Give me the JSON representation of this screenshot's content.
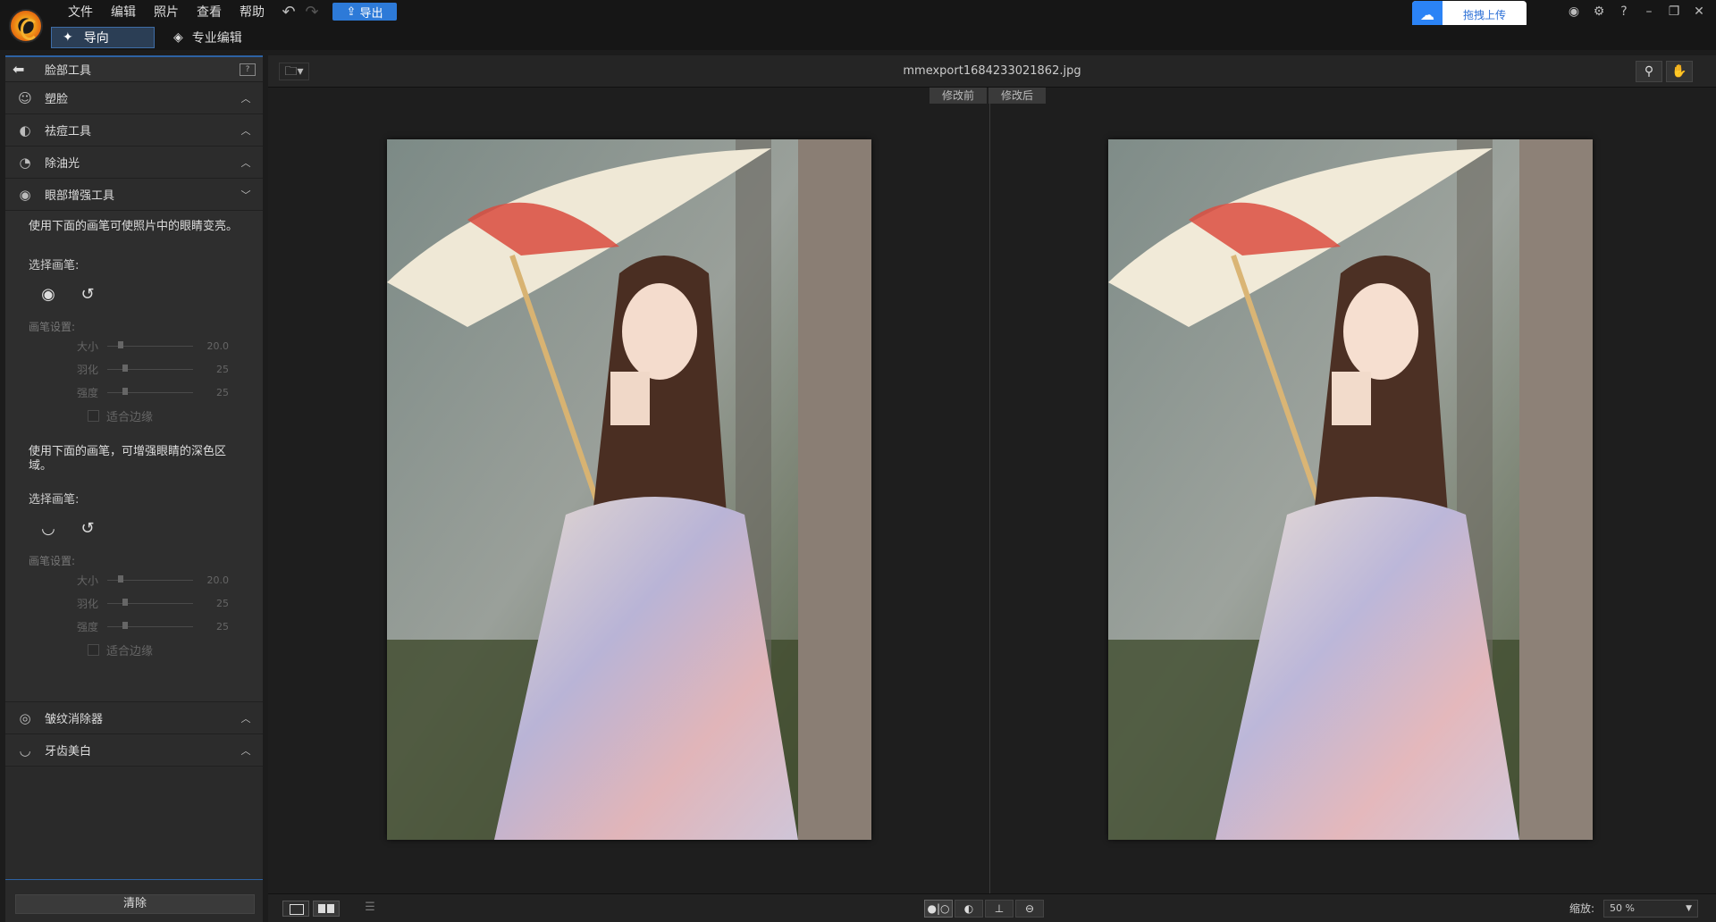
{
  "menubar": {
    "menus": [
      "文件",
      "编辑",
      "照片",
      "查看",
      "帮助"
    ],
    "export_label": "导出",
    "upload_label": "拖拽上传"
  },
  "modebar": {
    "guide_label": "导向",
    "pro_label": "专业编辑"
  },
  "leftpanel": {
    "title": "脸部工具",
    "sections_top": [
      {
        "label": "塑脸",
        "icon": "face-shape-icon"
      },
      {
        "label": "祛痘工具",
        "icon": "blemish-icon"
      },
      {
        "label": "除油光",
        "icon": "shine-icon"
      }
    ],
    "eye_section": {
      "label": "眼部增强工具",
      "desc1": "使用下面的画笔可使照片中的眼睛变亮。",
      "select_brush": "选择画笔:",
      "brush_settings": "画笔设置:",
      "sliders1": [
        {
          "label": "大小",
          "value": "20.0",
          "pos": 0.08
        },
        {
          "label": "羽化",
          "value": "25",
          "pos": 0.13
        },
        {
          "label": "强度",
          "value": "25",
          "pos": 0.13
        }
      ],
      "fit_edge": "适合边缘",
      "desc2": "使用下面的画笔，可增强眼睛的深色区域。",
      "sliders2": [
        {
          "label": "大小",
          "value": "20.0",
          "pos": 0.08
        },
        {
          "label": "羽化",
          "value": "25",
          "pos": 0.13
        },
        {
          "label": "强度",
          "value": "25",
          "pos": 0.13
        }
      ]
    },
    "sections_bottom": [
      {
        "label": "皱纹消除器",
        "icon": "wrinkle-icon"
      },
      {
        "label": "牙齿美白",
        "icon": "teeth-icon"
      }
    ],
    "clear_label": "清除"
  },
  "canvas": {
    "filename": "mmexport1684233021862.jpg",
    "before_label": "修改前",
    "after_label": "修改后"
  },
  "bottombar": {
    "zoom_label": "缩放:",
    "zoom_value": "50 %"
  }
}
